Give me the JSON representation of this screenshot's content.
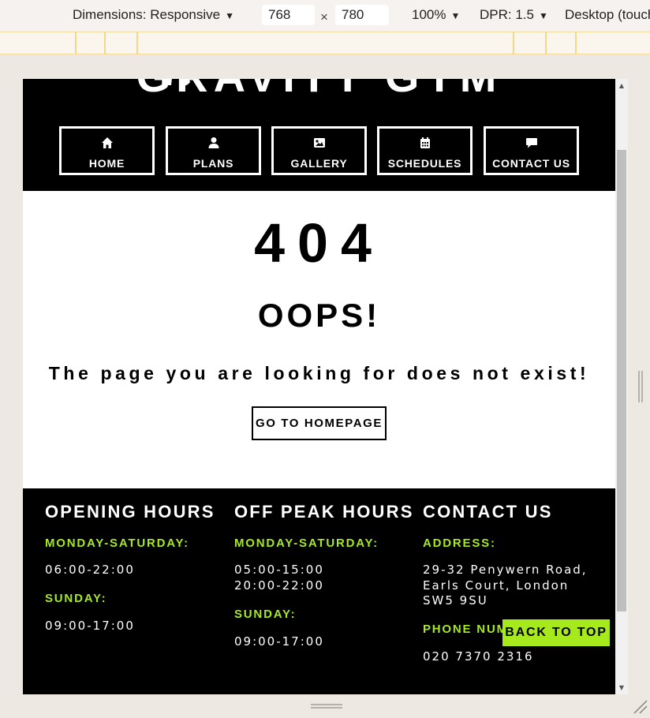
{
  "devtools": {
    "dimensions_label": "Dimensions: Responsive",
    "width_value": "768",
    "times_sign": "×",
    "height_value": "780",
    "zoom": "100%",
    "dpr": "DPR: 1.5",
    "device_mode": "Desktop (touch)"
  },
  "header": {
    "brand": "GRAVITY GYM",
    "nav": [
      {
        "label": "HOME",
        "icon": "home-icon"
      },
      {
        "label": "PLANS",
        "icon": "user-icon"
      },
      {
        "label": "GALLERY",
        "icon": "image-icon"
      },
      {
        "label": "SCHEDULES",
        "icon": "calendar-icon"
      },
      {
        "label": "CONTACT US",
        "icon": "comment-icon"
      }
    ]
  },
  "main": {
    "code": "404",
    "title": "OOPS!",
    "message": "The page you are looking for does not exist!",
    "button": "GO TO HOMEPAGE"
  },
  "footer": {
    "opening": {
      "title": "OPENING HOURS",
      "weekday_label": "MONDAY-SATURDAY:",
      "weekday_hours": "06:00-22:00",
      "sunday_label": "SUNDAY:",
      "sunday_hours": "09:00-17:00"
    },
    "offpeak": {
      "title": "OFF PEAK HOURS",
      "weekday_label": "MONDAY-SATURDAY:",
      "weekday_hours_1": "05:00-15:00",
      "weekday_hours_2": "20:00-22:00",
      "sunday_label": "SUNDAY:",
      "sunday_hours": "09:00-17:00"
    },
    "contact": {
      "title": "CONTACT US",
      "address_label": "ADDRESS:",
      "address_1": "29-32 Penywern Road,",
      "address_2": "Earls Court, London",
      "address_3": "SW5 9SU",
      "phone_label": "PHONE NUMBER:",
      "phone": "020 7370 2316"
    },
    "back_to_top": "BACK TO TOP"
  },
  "colors": {
    "accent": "#a6ea1e",
    "header_bg": "#000000",
    "footer_bg": "#000000"
  }
}
